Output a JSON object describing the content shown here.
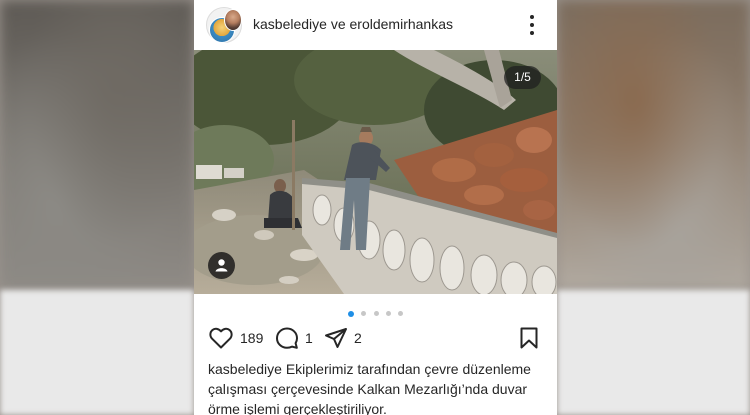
{
  "post": {
    "account_name": "kasbelediye ve eroldemirhankas",
    "image_counter": "1/5",
    "slide_dots": {
      "total": 5,
      "active_index": 0
    },
    "likes": "189",
    "comments": "1",
    "shares": "2",
    "caption_user": "kasbelediye",
    "caption_text": "Ekiplerimiz tarafından çevre düzenleme çalışması çerçevesinde Kalkan Mezarlığı’nda duvar örme işlemi gerçekleştiriliyor."
  },
  "icons": {
    "more": "more-vertical-icon",
    "like": "heart-icon",
    "comment": "comment-bubble-icon",
    "share": "paper-plane-icon",
    "save": "bookmark-icon",
    "tag": "user-tag-icon"
  },
  "colors": {
    "active_dot": "#1f8fe6",
    "text": "#262626"
  }
}
